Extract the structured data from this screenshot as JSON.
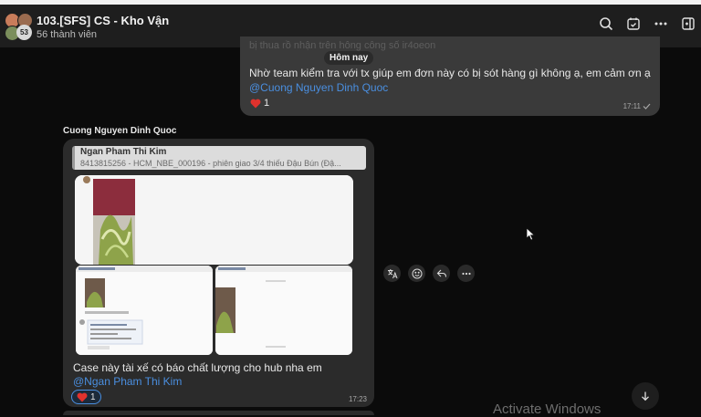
{
  "header": {
    "title": "103.[SFS] CS - Kho Vận",
    "subtitle": "56 thành viên",
    "avatar_count": "53",
    "icons": [
      "search-icon",
      "calendar-check-icon",
      "more-horizontal-icon",
      "side-panel-icon"
    ]
  },
  "own_message": {
    "faded_text": "bị thua rồ nhận trên hông công số ir4oeon",
    "date_label": "Hôm nay",
    "text": "Nhờ team kiểm tra  với tx giúp em đơn này có bị sót hàng gì không ạ, em cảm ơn ạ",
    "mention": "@Cuong Nguyen Dinh Quoc",
    "reaction_count": "1",
    "time": "17:11"
  },
  "other_message": {
    "sender": "Cuong Nguyen Dinh Quoc",
    "quote_name": "Ngan Pham Thi Kim",
    "quote_text": "8413815256 - HCM_NBE_000196 - phiên giao 3/4 thiếu Đậu Bún (Đậ...",
    "text": "Case này tài xế có báo chất lượng cho hub nha em ",
    "mention": "@Ngan Pham Thi Kim",
    "reaction_count": "1",
    "time": "17:23"
  },
  "watermark": "Activate Windows",
  "colors": {
    "accent": "#4a8fe0",
    "reaction": "#e0322d",
    "bubble_own": "#3a3a3a",
    "bubble_other": "#2b2b2b"
  }
}
